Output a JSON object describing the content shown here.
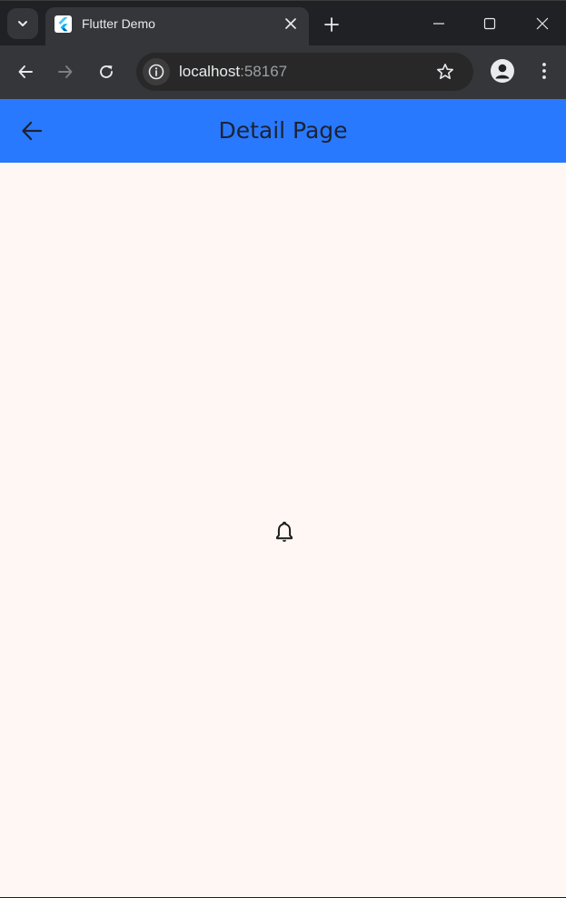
{
  "browser": {
    "tab": {
      "title": "Flutter Demo",
      "favicon": "flutter-logo"
    },
    "address_bar": {
      "host": "localhost",
      "port": ":58167"
    },
    "icons": {
      "tab_search": "chevron-down-icon",
      "tab_close": "close-icon",
      "new_tab": "plus-icon",
      "minimize": "minimize-icon",
      "maximize": "maximize-icon",
      "close_window": "close-icon",
      "back": "arrow-left-icon",
      "forward": "arrow-right-icon",
      "reload": "reload-icon",
      "site_info": "info-icon",
      "bookmark": "star-icon",
      "profile": "profile-icon",
      "menu": "kebab-menu-icon"
    }
  },
  "app": {
    "app_bar": {
      "title": "Detail Page",
      "back_icon": "arrow-left-icon"
    },
    "body": {
      "center_icon": "bell-icon"
    }
  },
  "colors": {
    "app_bar": "#2979ff",
    "body_background": "#fff7f3",
    "browser_chrome": "#35363a",
    "title_text": "#1c2333"
  }
}
